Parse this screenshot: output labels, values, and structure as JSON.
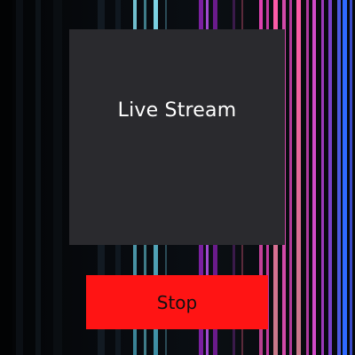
{
  "stream": {
    "title": "Live Stream"
  },
  "controls": {
    "stop_label": "Stop"
  },
  "colors": {
    "stop_button": "#ff1414",
    "preview_panel": "#2a2a2e",
    "background": "#050608"
  }
}
